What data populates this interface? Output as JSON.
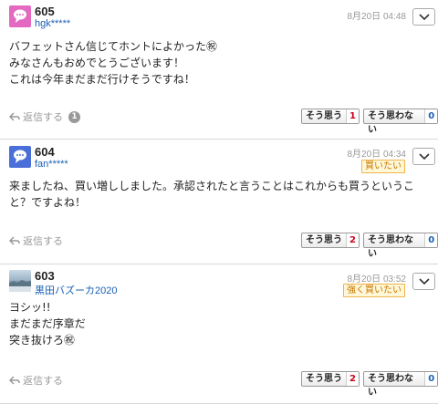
{
  "posts": [
    {
      "number": "605",
      "user": "hgk*****",
      "date": "8月20日 04:48",
      "badge": "",
      "lines": [
        "バフェットさん信じてホントによかった㊗",
        "みなさんもおめでとうございます！",
        "これは今年まだまだ行けそうですね！"
      ],
      "reply_label": "返信する",
      "reply_count": "1",
      "agree_label": "そう思う",
      "agree_count": "1",
      "disagree_label": "そう思わない",
      "disagree_count": "0",
      "avatar_color": "#e36ac0"
    },
    {
      "number": "604",
      "user": "fan*****",
      "date": "8月20日 04:34",
      "badge": "買いたい",
      "lines": [
        "来ましたね、買い増ししました。承認されたと言うことはこれからも買うというこ",
        "と？ですよね！"
      ],
      "reply_label": "返信する",
      "reply_count": "",
      "agree_label": "そう思う",
      "agree_count": "2",
      "disagree_label": "そう思わない",
      "disagree_count": "0",
      "avatar_color": "#4a6fd8"
    },
    {
      "number": "603",
      "user": "黒田バズーカ2020",
      "date": "8月20日 03:52",
      "badge": "強く買いたい",
      "lines": [
        "ヨシッ!!",
        "まだまだ序章だ",
        "突き抜けろ㊗"
      ],
      "reply_label": "返信する",
      "reply_count": "",
      "agree_label": "そう思う",
      "agree_count": "2",
      "disagree_label": "そう思わない",
      "disagree_count": "0",
      "avatar_color": "#7fa0b5"
    }
  ],
  "icons": {
    "menu": "chevron-down-icon",
    "reply": "reply-arrow-icon"
  }
}
